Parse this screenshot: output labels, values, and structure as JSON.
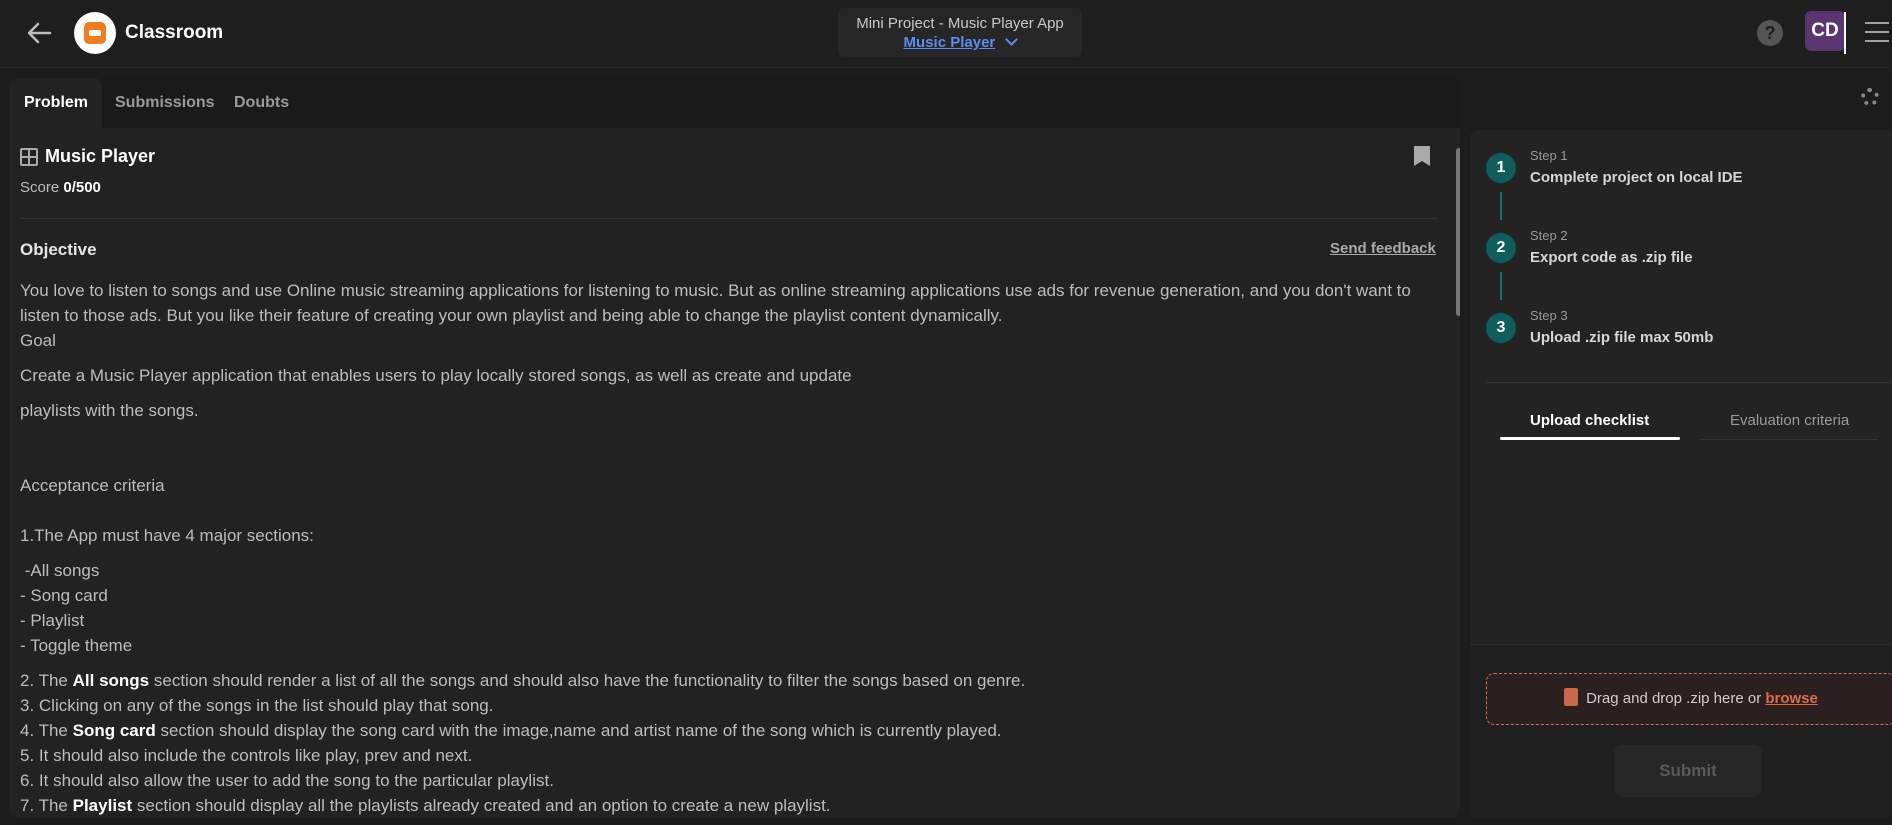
{
  "header": {
    "brand": "Classroom",
    "project_title": "Mini Project - Music Player App",
    "project_sub": "Music Player",
    "help": "?",
    "avatar_initials": "CD"
  },
  "tabs": [
    {
      "label": "Problem"
    },
    {
      "label": "Submissions"
    },
    {
      "label": "Doubts"
    }
  ],
  "problem": {
    "title": "Music Player",
    "score_label": "Score",
    "score_value": "0/500",
    "objective_heading": "Objective",
    "send_feedback": "Send feedback",
    "paragraphs": [
      "You love to listen to songs and use Online music streaming applications for listening to music. But as online streaming applications use ads for revenue generation, and you don't want to listen to those ads. But you like their feature of creating your own playlist and being able to change the playlist content dynamically.",
      "Goal",
      "Create a Music Player application that enables users to play locally stored songs, as well as create and update",
      "playlists with the songs.",
      "Acceptance criteria",
      "1.The App must have 4 major sections:",
      " -All songs",
      "- Song card",
      "- Playlist",
      "- Toggle theme"
    ],
    "criteria": [
      {
        "pre": "2. The ",
        "bold": "All songs",
        "post": " section should render a list of all the songs and should also have the functionality to filter the songs based on genre."
      },
      {
        "pre": "3. Clicking on any of the songs in the list should play that song.",
        "bold": "",
        "post": ""
      },
      {
        "pre": "4. The ",
        "bold": "Song card",
        "post": " section should display the song card with the image,name and artist name of the song which is currently played."
      },
      {
        "pre": "5. It should also include the controls like play, prev and next.",
        "bold": "",
        "post": ""
      },
      {
        "pre": "6. It should also allow the user to add the song to the particular playlist.",
        "bold": "",
        "post": ""
      },
      {
        "pre": "7. The ",
        "bold": "Playlist",
        "post": " section should display all the playlists already created and an option to create a new playlist."
      }
    ]
  },
  "steps": [
    {
      "label": "Step 1",
      "text": "Complete project on local IDE",
      "num": "1"
    },
    {
      "label": "Step 2",
      "text": "Export code as .zip file",
      "num": "2"
    },
    {
      "label": "Step 3",
      "text": "Upload .zip file max 50mb",
      "num": "3"
    }
  ],
  "right_tabs": {
    "upload_checklist": "Upload checklist",
    "evaluation_criteria": "Evaluation criteria"
  },
  "upload": {
    "drag_text": "Drag and drop .zip here or ",
    "browse": "browse",
    "submit": "Submit"
  }
}
